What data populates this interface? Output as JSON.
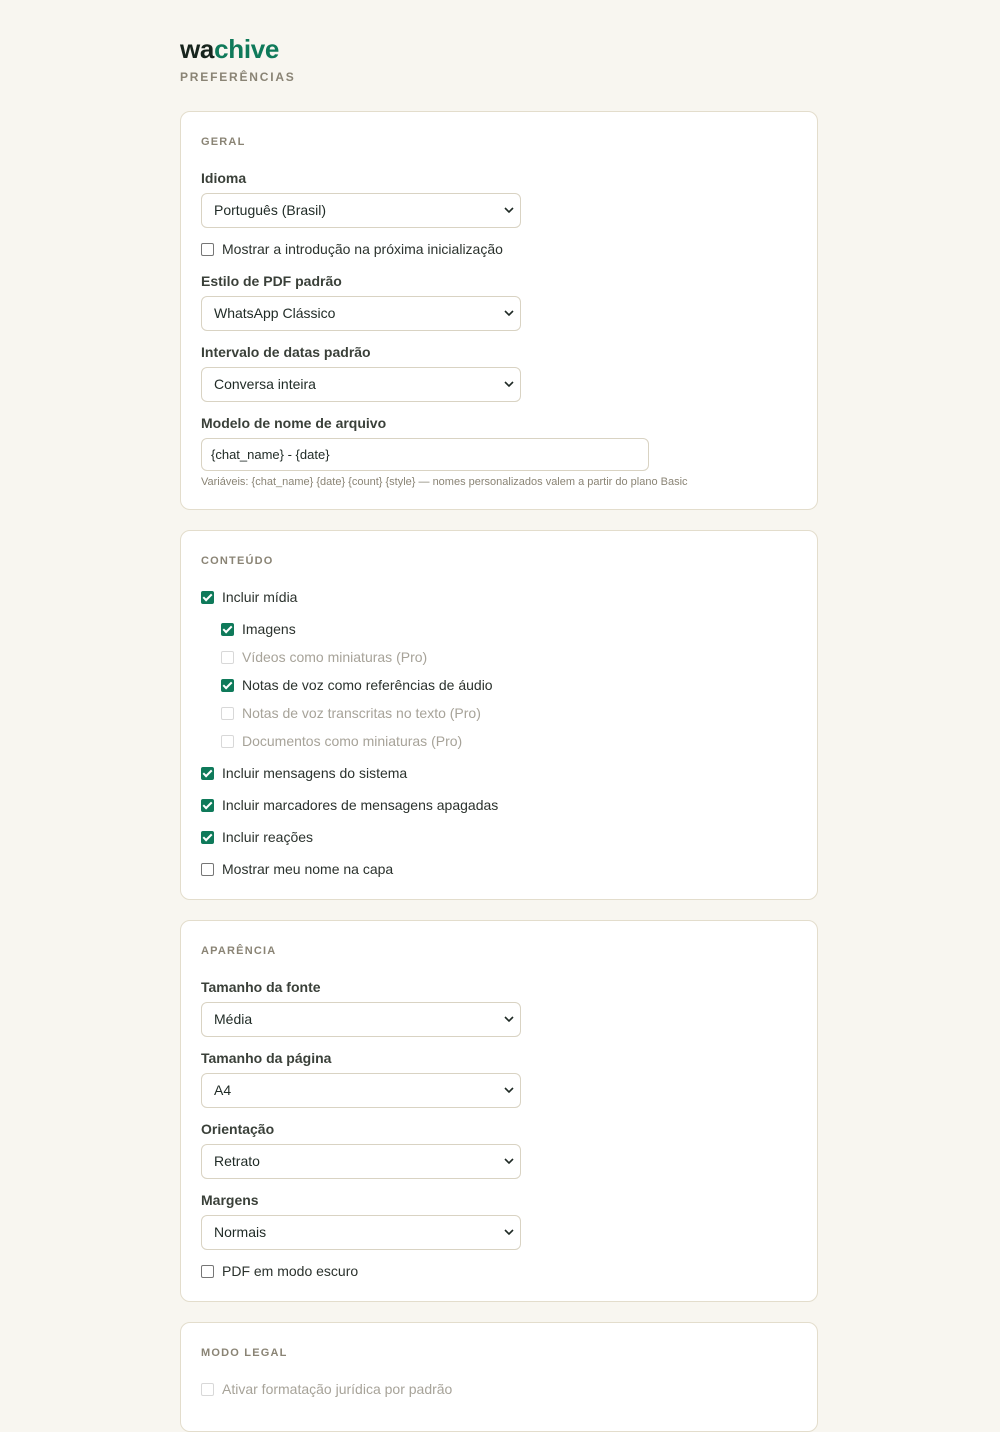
{
  "brand": {
    "part1": "wa",
    "part2": "chive"
  },
  "page_subtitle": "PREFERÊNCIAS",
  "general": {
    "title": "GERAL",
    "language_label": "Idioma",
    "language_value": "Português (Brasil)",
    "show_intro_label": "Mostrar a introdução na próxima inicialização",
    "show_intro_checked": false,
    "pdf_style_label": "Estilo de PDF padrão",
    "pdf_style_value": "WhatsApp Clássico",
    "date_range_label": "Intervalo de datas padrão",
    "date_range_value": "Conversa inteira",
    "filename_label": "Modelo de nome de arquivo",
    "filename_value": "{chat_name} - {date}",
    "filename_hint": "Variáveis: {chat_name} {date} {count} {style} — nomes personalizados valem a partir do plano Basic"
  },
  "content": {
    "title": "CONTEÚDO",
    "include_media": {
      "label": "Incluir mídia",
      "checked": true
    },
    "media_options": [
      {
        "label": "Imagens",
        "checked": true,
        "disabled": false
      },
      {
        "label": "Vídeos como miniaturas (Pro)",
        "checked": false,
        "disabled": true
      },
      {
        "label": "Notas de voz como referências de áudio",
        "checked": true,
        "disabled": false
      },
      {
        "label": "Notas de voz transcritas no texto (Pro)",
        "checked": false,
        "disabled": true
      },
      {
        "label": "Documentos como miniaturas (Pro)",
        "checked": false,
        "disabled": true
      }
    ],
    "system_messages": {
      "label": "Incluir mensagens do sistema",
      "checked": true
    },
    "deleted_markers": {
      "label": "Incluir marcadores de mensagens apagadas",
      "checked": true
    },
    "reactions": {
      "label": "Incluir reações",
      "checked": true
    },
    "show_name_cover": {
      "label": "Mostrar meu nome na capa",
      "checked": false
    }
  },
  "appearance": {
    "title": "APARÊNCIA",
    "font_size_label": "Tamanho da fonte",
    "font_size_value": "Média",
    "page_size_label": "Tamanho da página",
    "page_size_value": "A4",
    "orientation_label": "Orientação",
    "orientation_value": "Retrato",
    "margins_label": "Margens",
    "margins_value": "Normais",
    "dark_mode": {
      "label": "PDF em modo escuro",
      "checked": false
    }
  },
  "legal": {
    "title": "MODO LEGAL",
    "legal_format": {
      "label": "Ativar formatação jurídica por padrão",
      "checked": false,
      "disabled": true
    }
  },
  "colors": {
    "background": "#f8f6f0",
    "accent": "#0f7a5a",
    "muted": "#8a8475",
    "card": "#ffffff"
  }
}
